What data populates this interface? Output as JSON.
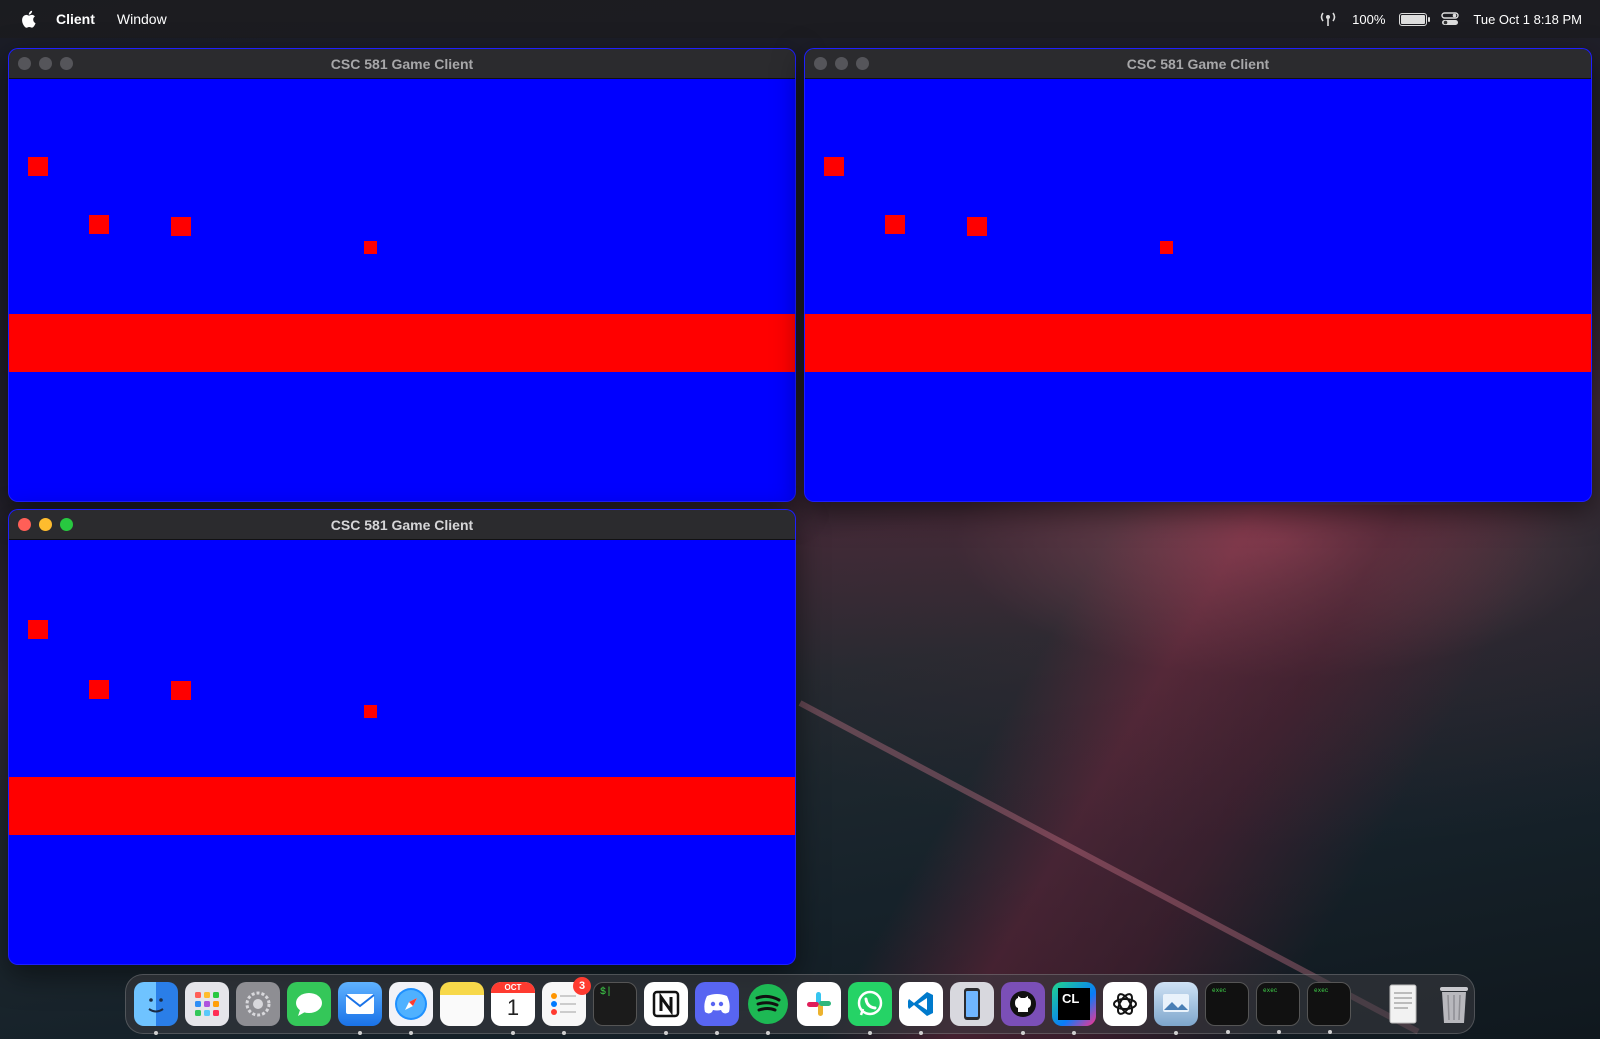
{
  "menubar": {
    "app_name": "Client",
    "menus": [
      "Window"
    ],
    "battery": "100%",
    "datetime": "Tue Oct 1  8:18 PM"
  },
  "windows": [
    {
      "title": "CSC 581 Game Client",
      "active": false
    },
    {
      "title": "CSC 581 Game Client",
      "active": false
    },
    {
      "title": "CSC 581 Game Client",
      "active": true
    }
  ],
  "colors": {
    "background": "#0000ff",
    "objects": "#ff0000"
  },
  "dock": {
    "apps": [
      {
        "name": "Finder",
        "icon": "finder-icon",
        "color": "#2a8cf0",
        "running": true
      },
      {
        "name": "Launchpad",
        "icon": "launchpad-icon",
        "color": "#e9e9ee",
        "running": false
      },
      {
        "name": "System Settings",
        "icon": "settings-icon",
        "color": "#8e8e93",
        "running": false
      },
      {
        "name": "Messages",
        "icon": "messages-icon",
        "color": "#34c759",
        "running": false
      },
      {
        "name": "Mail",
        "icon": "mail-icon",
        "color": "#2f8ef5",
        "running": true
      },
      {
        "name": "Safari",
        "icon": "safari-icon",
        "color": "#1e90ff",
        "running": true
      },
      {
        "name": "Notes",
        "icon": "notes-icon",
        "color": "#f7d84a",
        "running": false
      },
      {
        "name": "Calendar",
        "icon": "calendar-icon",
        "color": "#ffffff",
        "running": true,
        "month": "OCT",
        "day": "1"
      },
      {
        "name": "Reminders",
        "icon": "reminders-icon",
        "color": "#f2f2f2",
        "running": true,
        "badge": "3"
      },
      {
        "name": "Terminal",
        "icon": "terminal-icon",
        "color": "#1b1b1b",
        "running": false
      },
      {
        "name": "Notion",
        "icon": "notion-icon",
        "color": "#ffffff",
        "running": true
      },
      {
        "name": "Discord",
        "icon": "discord-icon",
        "color": "#5865f2",
        "running": true
      },
      {
        "name": "Spotify",
        "icon": "spotify-icon",
        "color": "#1db954",
        "running": true
      },
      {
        "name": "Slack",
        "icon": "slack-icon",
        "color": "#ffffff",
        "running": false
      },
      {
        "name": "WhatsApp",
        "icon": "whatsapp-icon",
        "color": "#25d366",
        "running": true
      },
      {
        "name": "VS Code",
        "icon": "vscode-icon",
        "color": "#ffffff",
        "running": true
      },
      {
        "name": "Xcode Simulator",
        "icon": "simulator-icon",
        "color": "#c9c9cf",
        "running": false
      },
      {
        "name": "GitHub Desktop",
        "icon": "github-icon",
        "color": "#7b4fb7",
        "running": true
      },
      {
        "name": "CLion",
        "icon": "clion-icon",
        "color": "#21d789",
        "running": true,
        "text": "CL"
      },
      {
        "name": "ChatGPT",
        "icon": "chatgpt-icon",
        "color": "#ffffff",
        "running": false
      },
      {
        "name": "Preview",
        "icon": "preview-icon",
        "color": "#9ab8d8",
        "running": true
      },
      {
        "name": "exec",
        "icon": "exec-icon",
        "color": "#111111",
        "running": true,
        "text": "exec"
      },
      {
        "name": "exec",
        "icon": "exec-icon",
        "color": "#111111",
        "running": true,
        "text": "exec"
      },
      {
        "name": "exec",
        "icon": "exec-icon",
        "color": "#111111",
        "running": true,
        "text": "exec"
      }
    ],
    "trailing": [
      {
        "name": "Documents",
        "icon": "documents-icon",
        "color": "#e6e6e6"
      },
      {
        "name": "Trash",
        "icon": "trash-icon",
        "color": "#b8b8bd"
      }
    ]
  }
}
